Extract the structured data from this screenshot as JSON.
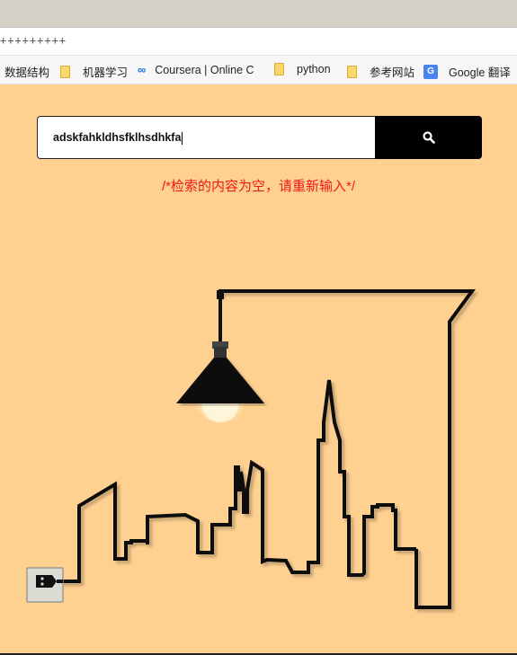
{
  "browser": {
    "address_text": "+++++++++",
    "bookmarks": [
      {
        "label": "数据结构",
        "icon": "folder-icon"
      },
      {
        "label": "机器学习",
        "icon": "folder-icon"
      },
      {
        "label": "Coursera | Online C",
        "icon": "coursera-icon"
      },
      {
        "label": "python",
        "icon": "folder-icon"
      },
      {
        "label": "参考网站",
        "icon": "folder-icon"
      },
      {
        "label": "Google 翻译",
        "icon": "google-translate-icon"
      }
    ]
  },
  "search": {
    "value": "adskfahkldhsfklhsdhkfa",
    "button_icon": "search-icon",
    "error_message": "/*检索的内容为空，请重新输入*/"
  },
  "illustration": {
    "elements": [
      "hanging-lamp",
      "light-bulb",
      "city-skyline",
      "power-plug"
    ]
  }
}
